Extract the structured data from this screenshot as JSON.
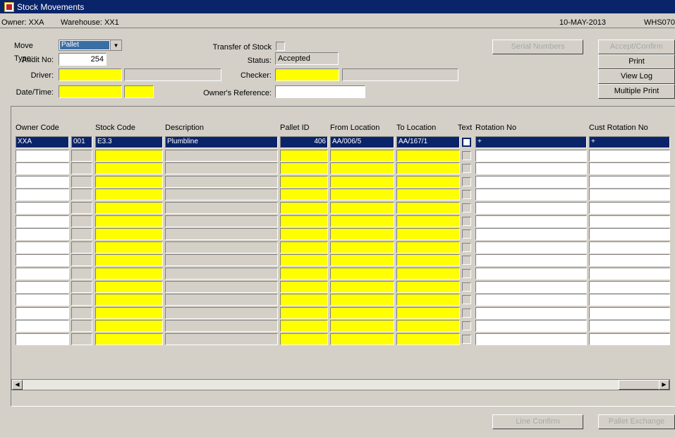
{
  "window": {
    "title": "Stock Movements"
  },
  "infobar": {
    "owner": "Owner: XXA",
    "warehouse": "Warehouse: XX1",
    "date": "10-MAY-2013",
    "code": "WHS070"
  },
  "form": {
    "move_type_label": "Move Type:",
    "move_type_value": "Pallet",
    "audit_label": "Audit No:",
    "audit_value": "254",
    "driver_label": "Driver:",
    "datetime_label": "Date/Time:",
    "transfer_label": "Transfer of Stock",
    "status_label": "Status:",
    "status_value": "Accepted",
    "checker_label": "Checker:",
    "owner_ref_label": "Owner's Reference:"
  },
  "buttons": {
    "serial_numbers": "Serial Numbers",
    "accept_confirm": "Accept/Confirm",
    "print": "Print",
    "view_log": "View Log",
    "multiple_print": "Multiple Print",
    "line_confirm": "Line Confirm",
    "pallet_exchange": "Pallet Exchange"
  },
  "grid": {
    "headers": {
      "owner_code": "Owner Code",
      "stock_code": "Stock Code",
      "description": "Description",
      "pallet_id": "Pallet ID",
      "from_location": "From Location",
      "to_location": "To Location",
      "text": "Text",
      "rotation_no": "Rotation No",
      "cust_rotation_no": "Cust Rotation No"
    },
    "rows": [
      {
        "owner_code": "XXA",
        "seq": "001",
        "stock_code": "E3.3",
        "description": "Plumbline",
        "pallet_id": "406",
        "from_location": "AA/006/5",
        "to_location": "AA/167/1",
        "rotation_no": "+",
        "cust_rotation_no": "+"
      }
    ]
  }
}
